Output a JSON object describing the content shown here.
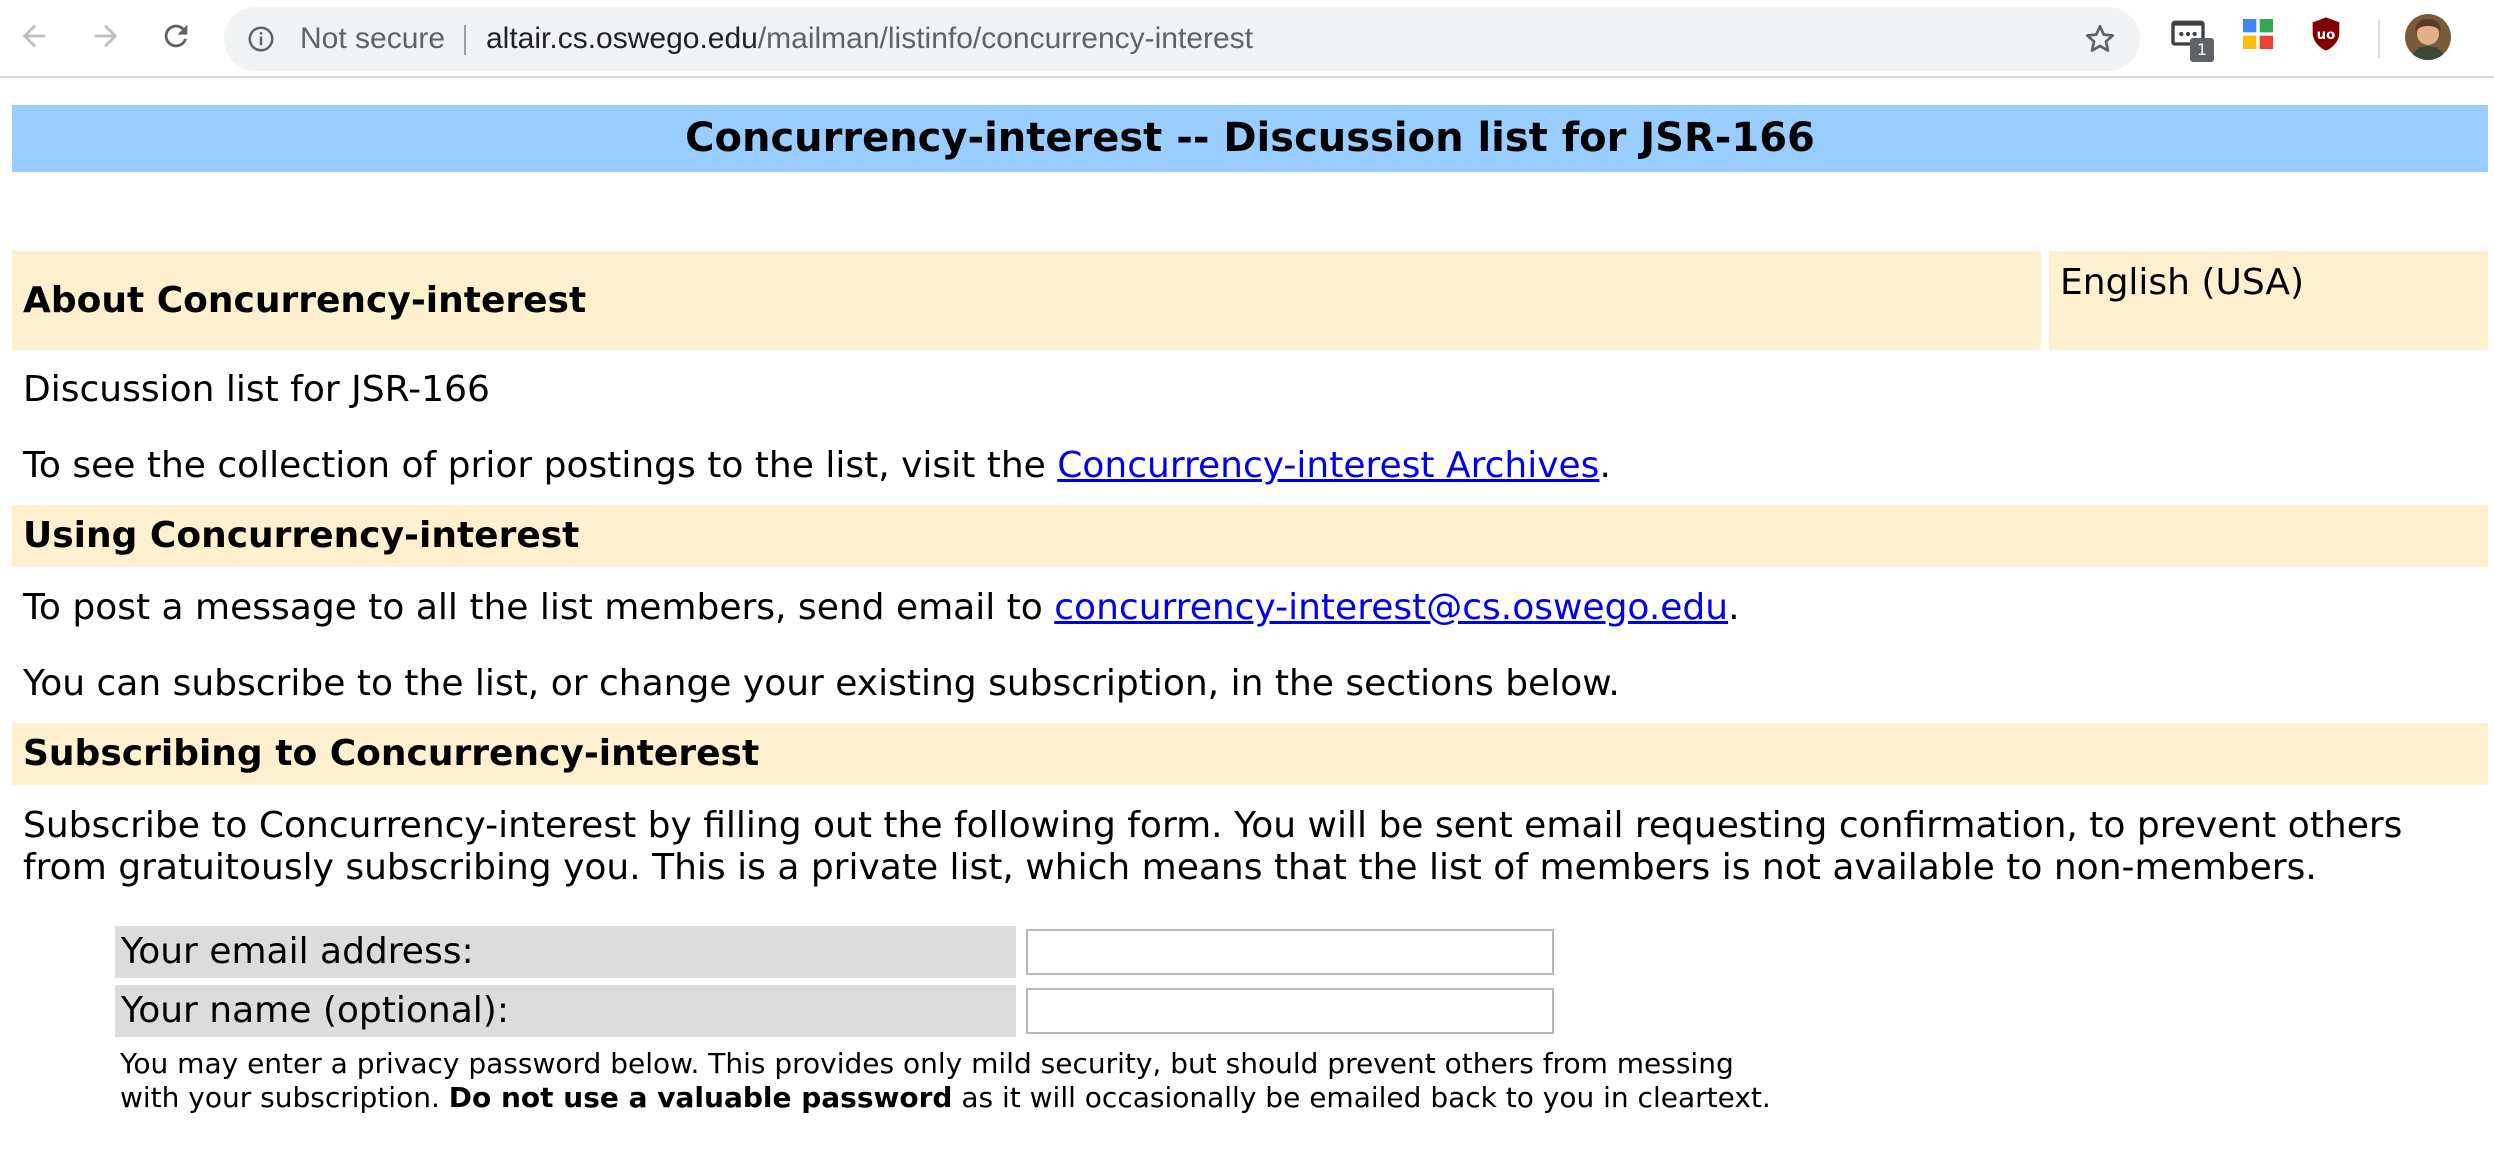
{
  "browser": {
    "security_label": "Not secure",
    "url_host": "altair.cs.oswego.edu",
    "url_path": "/mailman/listinfo/concurrency-interest",
    "extension_badge_count": "1"
  },
  "page": {
    "title": "Concurrency-interest -- Discussion list for JSR-166",
    "about": {
      "heading": "About Concurrency-interest",
      "language": "English (USA)",
      "description": "Discussion list for JSR-166",
      "archives_prefix": "To see the collection of prior postings to the list, visit the ",
      "archives_link": "Concurrency-interest Archives",
      "archives_suffix": "."
    },
    "using": {
      "heading": "Using Concurrency-interest",
      "post_prefix": "To post a message to all the list members, send email to ",
      "post_email": "concurrency-interest@cs.oswego.edu",
      "post_suffix": ".",
      "subscribe_note": "You can subscribe to the list, or change your existing subscription, in the sections below."
    },
    "subscribing": {
      "heading": "Subscribing to Concurrency-interest",
      "intro": "Subscribe to Concurrency-interest by filling out the following form. You will be sent email requesting confirmation, to prevent others from gratuitously subscribing you. This is a private list, which means that the list of members is not available to non-members.",
      "email_label": "Your email address:",
      "email_value": "",
      "name_label": "Your name (optional):",
      "name_value": "",
      "password_note_prefix": "You may enter a privacy password below. This provides only mild security, but should prevent others from messing with your subscription. ",
      "password_note_bold": "Do not use a valuable password",
      "password_note_suffix": " as it will occasionally be emailed back to you in cleartext."
    }
  }
}
